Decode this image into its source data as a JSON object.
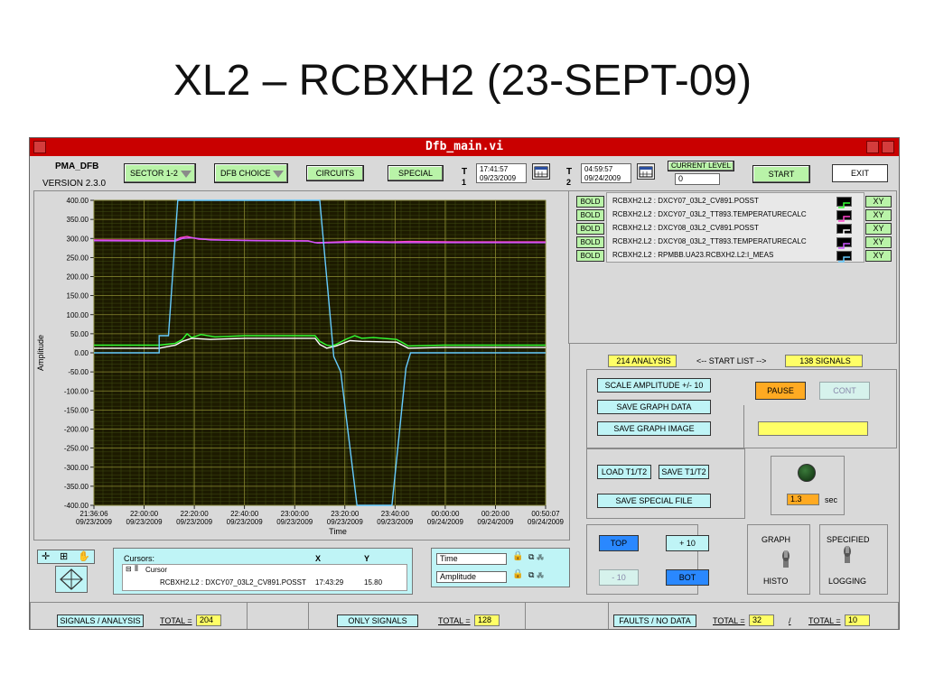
{
  "slide": {
    "title": "XL2 – RCBXH2 (23-SEPT-09)"
  },
  "window": {
    "title": "Dfb_main.vi"
  },
  "toolbar": {
    "app_name": "PMA_DFB",
    "version": "VERSION 2.3.0",
    "sector": "SECTOR 1-2",
    "dfb_choice": "DFB CHOICE",
    "circuits": "CIRCUITS",
    "special": "SPECIAL",
    "t1_label": "T",
    "t1_index": "1",
    "t1_time": "17:41:57",
    "t1_date": "09/23/2009",
    "t2_label": "T",
    "t2_index": "2",
    "t2_time": "04:59:57",
    "t2_date": "09/24/2009",
    "current_level_label": "CURRENT LEVEL",
    "current_level_value": "0",
    "start": "START",
    "exit": "EXIT"
  },
  "signals": {
    "bold_label": "BOLD",
    "xy_label": "XY",
    "items": [
      {
        "name": "RCBXH2.L2 : DXCY07_03L2_CV891.POSST",
        "color": "#33ff33"
      },
      {
        "name": "RCBXH2.L2 : DXCY07_03L2_TT893.TEMPERATURECALC",
        "color": "#ff44cc"
      },
      {
        "name": "RCBXH2.L2 : DXCY08_03L2_CV891.POSST",
        "color": "#ffffff"
      },
      {
        "name": "RCBXH2.L2 : DXCY08_03L2_TT893.TEMPERATURECALC",
        "color": "#cc55ff"
      },
      {
        "name": "RCBXH2.L2 : RPMBB.UA23.RCBXH2.L2:I_MEAS",
        "color": "#66ccff"
      }
    ]
  },
  "analysis": {
    "count_label": "214 ANALYSIS",
    "start_list": "<-- START LIST -->",
    "signals_label": "138 SIGNALS",
    "scale_amplitude": "SCALE AMPLITUDE +/- 10",
    "save_graph_data": "SAVE GRAPH DATA",
    "save_graph_image": "SAVE GRAPH IMAGE",
    "pause": "PAUSE",
    "cont": "CONT",
    "load_t1t2": "LOAD T1/T2",
    "save_t1t2": "SAVE T1/T2",
    "save_special_file": "SAVE SPECIAL FILE",
    "interval_value": "1.3",
    "interval_unit": "sec",
    "top": "TOP",
    "plus10": "+ 10",
    "minus10": "- 10",
    "bot": "BOT",
    "graph": "GRAPH",
    "histo": "HISTO",
    "specified": "SPECIFIED",
    "logging": "LOGGING"
  },
  "cursors": {
    "title": "Cursors:",
    "col_x": "X",
    "col_y": "Y",
    "cursor_name": "Cursor",
    "row_signal": "RCBXH2.L2 : DXCY07_03L2_CV891.POSST",
    "row_x": "17:43:29",
    "row_y": "15.80"
  },
  "scales": {
    "time": "Time",
    "amplitude": "Amplitude"
  },
  "bottom": {
    "signals_analysis": "SIGNALS / ANALYSIS",
    "total_label": "TOTAL =",
    "total1": "204",
    "only_signals": "ONLY SIGNALS",
    "total2": "128",
    "faults_no_data": "FAULTS / NO DATA",
    "total3": "32",
    "slash": "/",
    "total4": "10"
  },
  "chart_data": {
    "type": "line",
    "ylabel": "Amplitude",
    "xlabel": "Time",
    "ylim": [
      -400,
      400
    ],
    "yticks": [
      "400.00",
      "350.00",
      "300.00",
      "250.00",
      "200.00",
      "150.00",
      "100.00",
      "50.00",
      "0.00",
      "-50.00",
      "-100.00",
      "-150.00",
      "-200.00",
      "-250.00",
      "-300.00",
      "-350.00",
      "-400.00"
    ],
    "xticks": [
      {
        "time": "21:36:06",
        "date": "09/23/2009"
      },
      {
        "time": "22:00:00",
        "date": "09/23/2009"
      },
      {
        "time": "22:20:00",
        "date": "09/23/2009"
      },
      {
        "time": "22:40:00",
        "date": "09/23/2009"
      },
      {
        "time": "23:00:00",
        "date": "09/23/2009"
      },
      {
        "time": "23:20:00",
        "date": "09/23/2009"
      },
      {
        "time": "23:40:00",
        "date": "09/23/2009"
      },
      {
        "time": "00:00:00",
        "date": "09/24/2009"
      },
      {
        "time": "00:20:00",
        "date": "09/24/2009"
      },
      {
        "time": "00:50:07",
        "date": "09/24/2009"
      }
    ],
    "xrange": [
      0,
      194
    ],
    "grid": true,
    "series": [
      {
        "name": "RCBXH2.L2 : DXCY07_03L2_TT893.TEMPERATURECALC",
        "color": "#ff44cc",
        "points": [
          [
            0,
            296
          ],
          [
            35,
            295
          ],
          [
            37,
            302
          ],
          [
            40,
            305
          ],
          [
            45,
            298
          ],
          [
            55,
            296
          ],
          [
            70,
            295
          ],
          [
            92,
            294
          ],
          [
            95,
            289
          ],
          [
            105,
            291
          ],
          [
            112,
            293
          ],
          [
            117,
            292
          ],
          [
            128,
            291
          ],
          [
            135,
            292
          ],
          [
            155,
            291
          ],
          [
            194,
            291
          ]
        ]
      },
      {
        "name": "RCBXH2.L2 : DXCY08_03L2_TT893.TEMPERATURECALC",
        "color": "#cc55ff",
        "points": [
          [
            0,
            294
          ],
          [
            35,
            293
          ],
          [
            38,
            300
          ],
          [
            42,
            302
          ],
          [
            50,
            296
          ],
          [
            70,
            294
          ],
          [
            92,
            293
          ],
          [
            96,
            288
          ],
          [
            110,
            290
          ],
          [
            130,
            289
          ],
          [
            194,
            289
          ]
        ]
      },
      {
        "name": "RCBXH2.L2 : DXCY07_03L2_CV891.POSST",
        "color": "#33ff33",
        "points": [
          [
            0,
            20
          ],
          [
            28,
            20
          ],
          [
            35,
            25
          ],
          [
            38,
            35
          ],
          [
            40,
            50
          ],
          [
            42,
            40
          ],
          [
            46,
            48
          ],
          [
            52,
            42
          ],
          [
            65,
            45
          ],
          [
            85,
            45
          ],
          [
            95,
            45
          ],
          [
            97,
            30
          ],
          [
            100,
            20
          ],
          [
            102,
            18
          ],
          [
            104,
            22
          ],
          [
            108,
            35
          ],
          [
            112,
            45
          ],
          [
            115,
            38
          ],
          [
            120,
            40
          ],
          [
            130,
            35
          ],
          [
            133,
            25
          ],
          [
            135,
            18
          ],
          [
            150,
            20
          ],
          [
            194,
            20
          ]
        ]
      },
      {
        "name": "RCBXH2.L2 : DXCY08_03L2_CV891.POSST",
        "color": "#ffffff",
        "points": [
          [
            0,
            12
          ],
          [
            28,
            12
          ],
          [
            35,
            20
          ],
          [
            38,
            30
          ],
          [
            42,
            38
          ],
          [
            50,
            35
          ],
          [
            65,
            38
          ],
          [
            95,
            38
          ],
          [
            97,
            22
          ],
          [
            100,
            12
          ],
          [
            104,
            18
          ],
          [
            110,
            32
          ],
          [
            115,
            30
          ],
          [
            130,
            28
          ],
          [
            135,
            12
          ],
          [
            150,
            14
          ],
          [
            194,
            14
          ]
        ]
      },
      {
        "name": "RCBXH2.L2 : RPMBB.UA23.RCBXH2.L2:I_MEAS",
        "color": "#66ccff",
        "points": [
          [
            0,
            0
          ],
          [
            28,
            0
          ],
          [
            28,
            45
          ],
          [
            32,
            45
          ],
          [
            36,
            400
          ],
          [
            97,
            400
          ],
          [
            103,
            -10
          ],
          [
            106,
            -50
          ],
          [
            113,
            -400
          ],
          [
            128,
            -400
          ],
          [
            134,
            -40
          ],
          [
            136,
            0
          ],
          [
            194,
            0
          ]
        ]
      }
    ]
  }
}
